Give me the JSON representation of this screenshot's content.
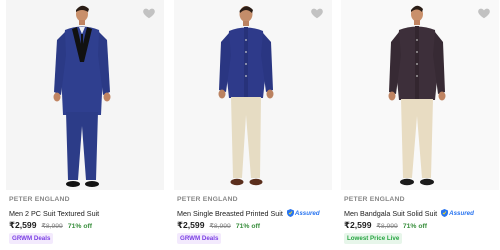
{
  "products": [
    {
      "brand": "PETER ENGLAND",
      "title": "Men 2 PC Suit Textured Suit",
      "assured": false,
      "price": "₹2,599",
      "mrp": "₹8,999",
      "discount": "71% off",
      "tag": "GRWM Deals",
      "tag_style": "purple"
    },
    {
      "brand": "PETER ENGLAND",
      "title": "Men Single Breasted Printed Suit",
      "assured": true,
      "price": "₹2,599",
      "mrp": "₹8,999",
      "discount": "71% off",
      "tag": "GRWM Deals",
      "tag_style": "purple"
    },
    {
      "brand": "PETER ENGLAND",
      "title": "Men Bandgala Suit Solid Suit",
      "assured": true,
      "price": "₹2,599",
      "mrp": "₹8,999",
      "discount": "71% off",
      "tag": "Lowest Price Live",
      "tag_style": "green"
    }
  ],
  "assured_label": "Assured",
  "colors": {
    "brand_grey": "#878787",
    "discount_green": "#388e3c",
    "assured_blue": "#2874f0",
    "deal_purple": "#7b3fe4",
    "lowest_price_green": "#26a541"
  },
  "icons": {
    "wishlist": "heart-icon",
    "assured": "assured-shield-icon"
  }
}
